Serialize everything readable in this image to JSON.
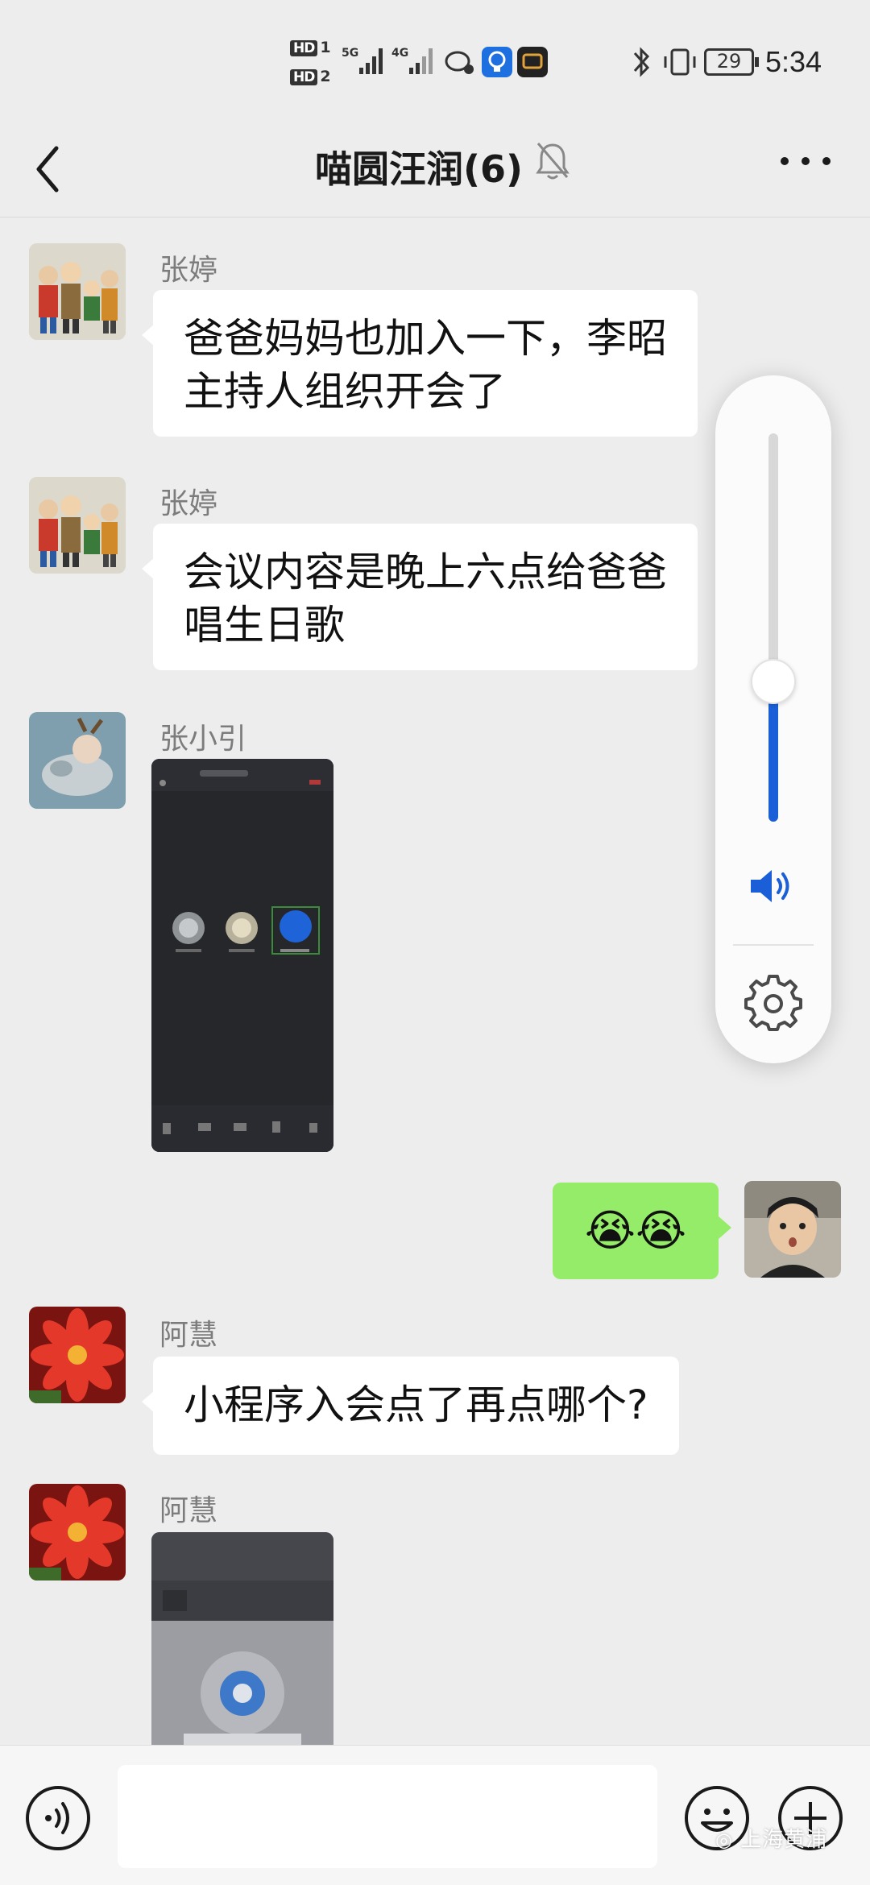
{
  "status_bar": {
    "hd1": "HD",
    "hd1_num": "1",
    "hd2": "HD",
    "hd2_num": "2",
    "net1": "5G",
    "net2": "4G",
    "battery": "29",
    "time": "5:34"
  },
  "header": {
    "title": "喵圆汪润(6)",
    "icons": [
      "back-arrow-icon",
      "mute-bell-icon",
      "more-icon"
    ]
  },
  "messages": [
    {
      "sender": "张婷",
      "type": "text",
      "text": "爸爸妈妈也加入一下，李昭\n主持人组织开会了"
    },
    {
      "sender": "张婷",
      "type": "text",
      "text": "会议内容是晚上六点给爸爸\n唱生日歌"
    },
    {
      "sender": "张小引",
      "type": "image",
      "description": "screenshot"
    },
    {
      "sender": "me",
      "type": "emoji",
      "text": "😭😭"
    },
    {
      "sender": "阿慧",
      "type": "text",
      "text": "小程序入会点了再点哪个?"
    },
    {
      "sender": "阿慧",
      "type": "image",
      "description": "screenshot"
    }
  ],
  "volume_panel": {
    "level": 0.36,
    "accent": "#1b5fd8",
    "icons": [
      "speaker-icon",
      "settings-gear-icon"
    ]
  },
  "input_bar": {
    "placeholder": "",
    "icons": [
      "voice-icon",
      "emoji-icon",
      "plus-icon"
    ]
  },
  "watermark": "上海黄浦",
  "colors": {
    "my_bubble": "#95ec69",
    "background": "#ededed"
  }
}
